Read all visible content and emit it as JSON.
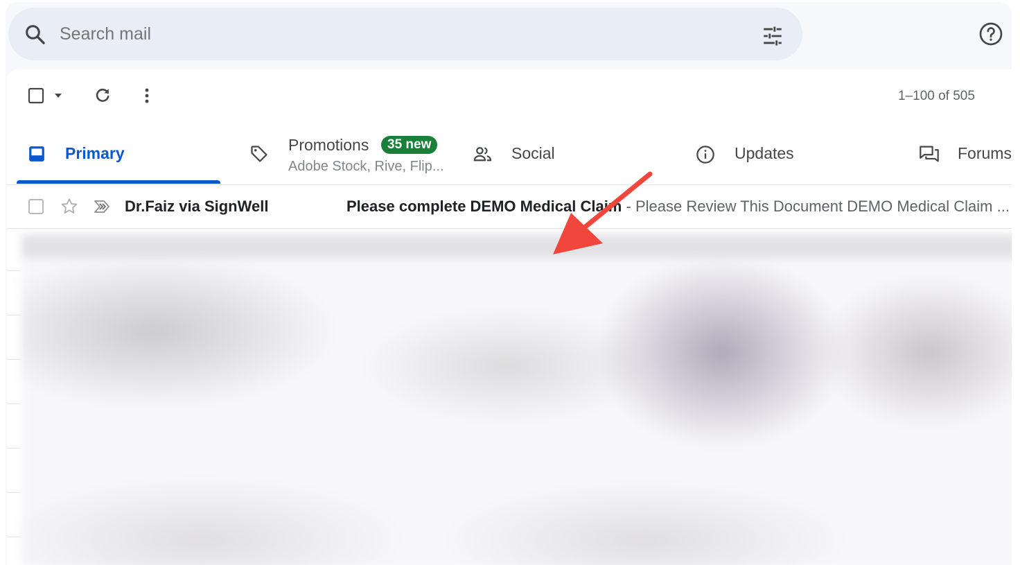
{
  "search": {
    "placeholder": "Search mail",
    "icons": [
      "search-icon",
      "tune-icon",
      "help-icon"
    ]
  },
  "toolbar": {
    "icons": [
      "checkbox-icon",
      "chevron-down-icon",
      "refresh-icon",
      "more-vert-icon"
    ],
    "pagination": "1–100 of 505"
  },
  "tabs": [
    {
      "label": "Primary",
      "icon": "inbox-icon",
      "active": true
    },
    {
      "label": "Promotions",
      "icon": "tag-icon",
      "badge": "35 new",
      "subtitle": "Adobe Stock, Rive, Flip..."
    },
    {
      "label": "Social",
      "icon": "people-icon"
    },
    {
      "label": "Updates",
      "icon": "info-icon"
    },
    {
      "label": "Forums",
      "icon": "forum-icon"
    }
  ],
  "emails": [
    {
      "sender": "Dr.Faiz via SignWell",
      "subject": "Please complete DEMO Medical Claim",
      "separator": " - ",
      "snippet": "Please Review This Document DEMO Medical Claim ..."
    }
  ],
  "colors": {
    "accent": "#0b57d0",
    "badge": "#188038",
    "annotation_arrow": "#f0463c",
    "search_bg": "#e9eef6"
  }
}
